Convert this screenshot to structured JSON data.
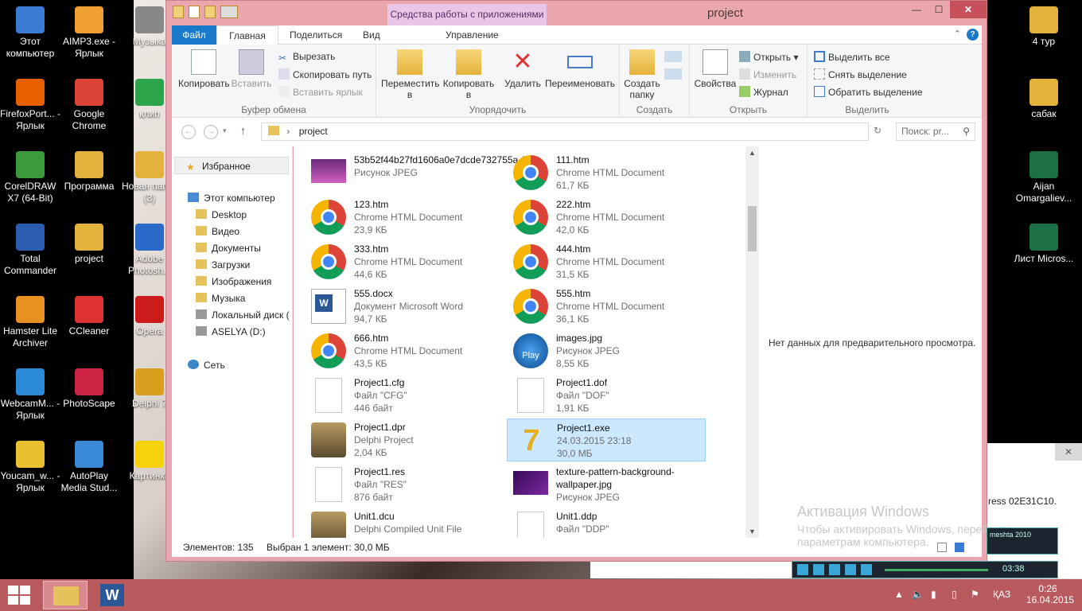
{
  "desktop_left": [
    {
      "label": "Этот компьютер",
      "icon": "computer-icon"
    },
    {
      "label": "AIMP3.exe - Ярлык",
      "icon": "aimp-icon"
    },
    {
      "label": "Музыка",
      "icon": "music-icon"
    },
    {
      "label": "FirefoxPort... - Ярлык",
      "icon": "firefox-icon"
    },
    {
      "label": "Google Chrome",
      "icon": "chrome-icon"
    },
    {
      "label": "клип",
      "icon": "play-icon"
    },
    {
      "label": "CorelDRAW X7 (64-Bit)",
      "icon": "coreldraw-icon"
    },
    {
      "label": "Программа",
      "icon": "folder-icon"
    },
    {
      "label": "Новая папка (3)",
      "icon": "folder-icon"
    },
    {
      "label": "Total Commander",
      "icon": "totalcmd-icon"
    },
    {
      "label": "project",
      "icon": "folder-icon"
    },
    {
      "label": "Adobe Photosh...",
      "icon": "photoshop-icon"
    },
    {
      "label": "Hamster Lite Archiver",
      "icon": "hamster-icon"
    },
    {
      "label": "CCleaner",
      "icon": "ccleaner-icon"
    },
    {
      "label": "Opera",
      "icon": "opera-icon"
    },
    {
      "label": "WebcamM... - Ярлык",
      "icon": "webcam-icon"
    },
    {
      "label": "PhotoScape",
      "icon": "photoscape-icon"
    },
    {
      "label": "Delphi 7",
      "icon": "delphi-icon"
    },
    {
      "label": "Youcam_w... - Ярлык",
      "icon": "youcam-icon"
    },
    {
      "label": "AutoPlay Media Stud...",
      "icon": "autoplay-icon"
    },
    {
      "label": "Картинка",
      "icon": "star-icon"
    }
  ],
  "desktop_right": [
    {
      "label": "4 тур",
      "icon": "folder-icon"
    },
    {
      "label": "сабак",
      "icon": "folder-icon"
    },
    {
      "label": "Aijan Omargaliev...",
      "icon": "excel-icon"
    },
    {
      "label": "Лист Micros...",
      "icon": "excel-icon"
    }
  ],
  "window": {
    "title": "project",
    "context_tab": "Средства работы с приложениями"
  },
  "ribbon_tabs": [
    "Файл",
    "Главная",
    "Поделиться",
    "Вид",
    "Управление"
  ],
  "ribbon": {
    "copy": "Копировать",
    "paste": "Вставить",
    "cut": "Вырезать",
    "copy_path": "Скопировать путь",
    "paste_shortcut": "Вставить ярлык",
    "clipboard": "Буфер обмена",
    "move": "Переместить в",
    "copy_to": "Копировать в",
    "delete": "Удалить",
    "rename": "Переименовать",
    "organize": "Упорядочить",
    "new_folder": "Создать папку",
    "create": "Создать",
    "properties": "Свойства",
    "open": "Открыть",
    "edit": "Изменить",
    "history": "Журнал",
    "open_group": "Открыть",
    "select_all": "Выделить все",
    "select_none": "Снять выделение",
    "invert": "Обратить выделение",
    "select": "Выделить"
  },
  "address": {
    "path": "project",
    "search_placeholder": "Поиск: pr..."
  },
  "nav": {
    "favorites": "Избранное",
    "this_pc": "Этот компьютер",
    "items": [
      "Desktop",
      "Видео",
      "Документы",
      "Загрузки",
      "Изображения",
      "Музыка",
      "Локальный диск (",
      "ASELYA (D:)"
    ],
    "network": "Сеть"
  },
  "files": [
    {
      "name": "53b52f44b27fd1606a0e7dcde732755a.JPG",
      "type": "Рисунок JPEG",
      "size": "",
      "icon": "image"
    },
    {
      "name": "111.htm",
      "type": "Chrome HTML Document",
      "size": "61,7 КБ",
      "icon": "chrome"
    },
    {
      "name": "123.htm",
      "type": "Chrome HTML Document",
      "size": "23,9 КБ",
      "icon": "chrome"
    },
    {
      "name": "222.htm",
      "type": "Chrome HTML Document",
      "size": "42,0 КБ",
      "icon": "chrome"
    },
    {
      "name": "333.htm",
      "type": "Chrome HTML Document",
      "size": "44,6 КБ",
      "icon": "chrome"
    },
    {
      "name": "444.htm",
      "type": "Chrome HTML Document",
      "size": "31,5 КБ",
      "icon": "chrome"
    },
    {
      "name": "555.docx",
      "type": "Документ Microsoft Word",
      "size": "94,7 КБ",
      "icon": "word"
    },
    {
      "name": "555.htm",
      "type": "Chrome HTML Document",
      "size": "36,1 КБ",
      "icon": "chrome"
    },
    {
      "name": "666.htm",
      "type": "Chrome HTML Document",
      "size": "43,5 КБ",
      "icon": "chrome"
    },
    {
      "name": "images.jpg",
      "type": "Рисунок JPEG",
      "size": "8,55 КБ",
      "icon": "play"
    },
    {
      "name": "Project1.cfg",
      "type": "Файл \"CFG\"",
      "size": "446 байт",
      "icon": "blank"
    },
    {
      "name": "Project1.dof",
      "type": "Файл \"DOF\"",
      "size": "1,91 КБ",
      "icon": "blank"
    },
    {
      "name": "Project1.dpr",
      "type": "Delphi Project",
      "size": "2,04 КБ",
      "icon": "delphi"
    },
    {
      "name": "Project1.exe",
      "type": "24.03.2015 23:18",
      "size": "30,0 МБ",
      "icon": "delphi7",
      "selected": true
    },
    {
      "name": "Project1.res",
      "type": "Файл \"RES\"",
      "size": "876 байт",
      "icon": "blank"
    },
    {
      "name": "texture-pattern-background-wallpaper.jpg",
      "type": "Рисунок JPEG",
      "size": "",
      "icon": "purple"
    },
    {
      "name": "Unit1.dcu",
      "type": "Delphi Compiled Unit File",
      "size": "",
      "icon": "delphi"
    },
    {
      "name": "Unit1.ddp",
      "type": "Файл \"DDP\"",
      "size": "",
      "icon": "blank"
    }
  ],
  "preview_text": "Нет данных для предварительного просмотра.",
  "status": {
    "count": "Элементов: 135",
    "selected": "Выбран 1 элемент: 30,0 МБ"
  },
  "activation": {
    "title": "Активация Windows",
    "line1": "Чтобы активировать Windows, перейдите к",
    "line2": "параметрам компьютера."
  },
  "player": {
    "name": "meshta 2010",
    "time": "03:38"
  },
  "side_panel_text": "ress 02E31C10.",
  "tray": {
    "lang": "ҚАЗ",
    "time": "0:26",
    "date": "16.04.2015"
  }
}
